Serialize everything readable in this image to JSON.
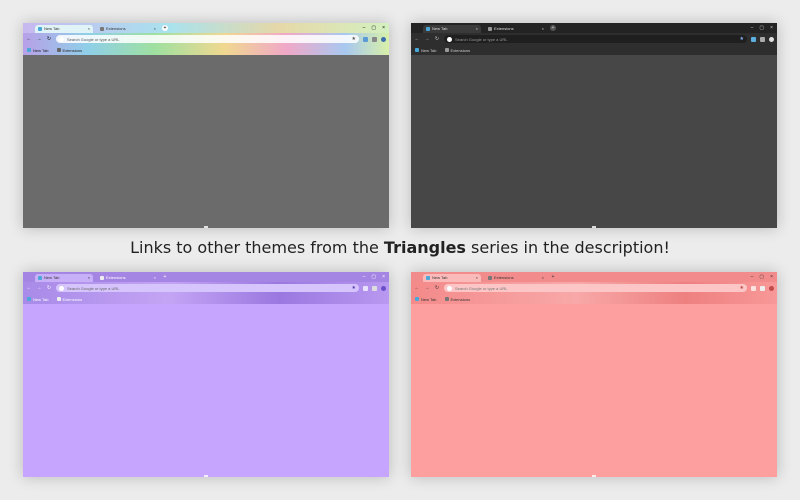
{
  "caption": {
    "before": "Links to other themes from the ",
    "bold": "Triangles",
    "after": " series in the description!"
  },
  "windows": [
    {
      "name": "rainbow",
      "tab1": "New Tab",
      "tab2": "Extensions",
      "omnibox": "Search Google or type a URL",
      "bm1": "New Tab",
      "bm2": "Extensions",
      "content_color": "#6b6b6b"
    },
    {
      "name": "dark",
      "tab1": "New Tab",
      "tab2": "Extensions",
      "omnibox": "Search Google or type a URL",
      "bm1": "New Tab",
      "bm2": "Extensions",
      "content_color": "#474747"
    },
    {
      "name": "purple",
      "tab1": "New Tab",
      "tab2": "Extensions",
      "omnibox": "Search Google or type a URL",
      "bm1": "New Tab",
      "bm2": "Extensions",
      "content_color": "#c6a5fe"
    },
    {
      "name": "red",
      "tab1": "New Tab",
      "tab2": "Extensions",
      "omnibox": "Search Google or type a URL",
      "bm1": "New Tab",
      "bm2": "Extensions",
      "content_color": "#fe9f9f"
    }
  ],
  "controls": {
    "close_tab": "×",
    "new_tab": "+",
    "minimize": "–",
    "maximize": "▢",
    "close_window": "×",
    "back": "←",
    "forward": "→",
    "reload": "↻",
    "star": "★"
  }
}
